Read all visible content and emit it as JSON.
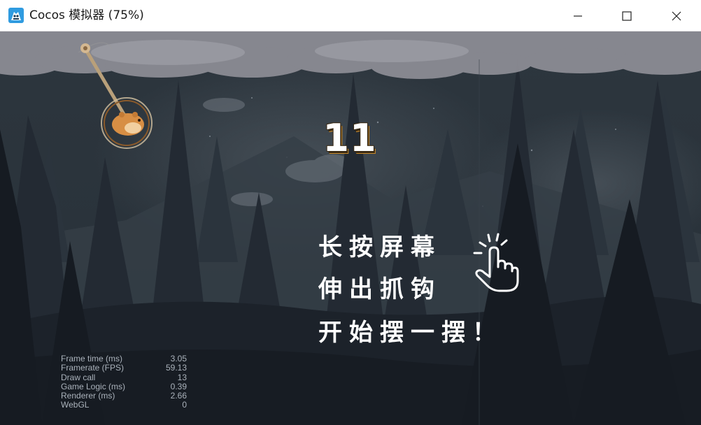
{
  "window": {
    "title": "Cocos 模拟器 (75%)",
    "icon": "cocos-app-icon",
    "controls": [
      "minimize-icon",
      "maximize-icon",
      "close-icon"
    ]
  },
  "game": {
    "score": "11",
    "instructions": [
      "长按屏幕",
      "伸出抓钩",
      "开始摆一摆！"
    ],
    "hint_icon": "tap-hand-icon"
  },
  "stats": [
    {
      "label": "Frame time (ms)",
      "value": "3.05"
    },
    {
      "label": "Framerate (FPS)",
      "value": "59.13"
    },
    {
      "label": "Draw call",
      "value": "13"
    },
    {
      "label": "Game Logic (ms)",
      "value": "0.39"
    },
    {
      "label": "Renderer (ms)",
      "value": "2.66"
    },
    {
      "label": "WebGL",
      "value": "0"
    }
  ],
  "colors": {
    "sky": "#242c34",
    "cloud": "#8e8e96",
    "tree": "#1a2028",
    "score_outline": "#c98a2a",
    "text": "#ffffff"
  }
}
